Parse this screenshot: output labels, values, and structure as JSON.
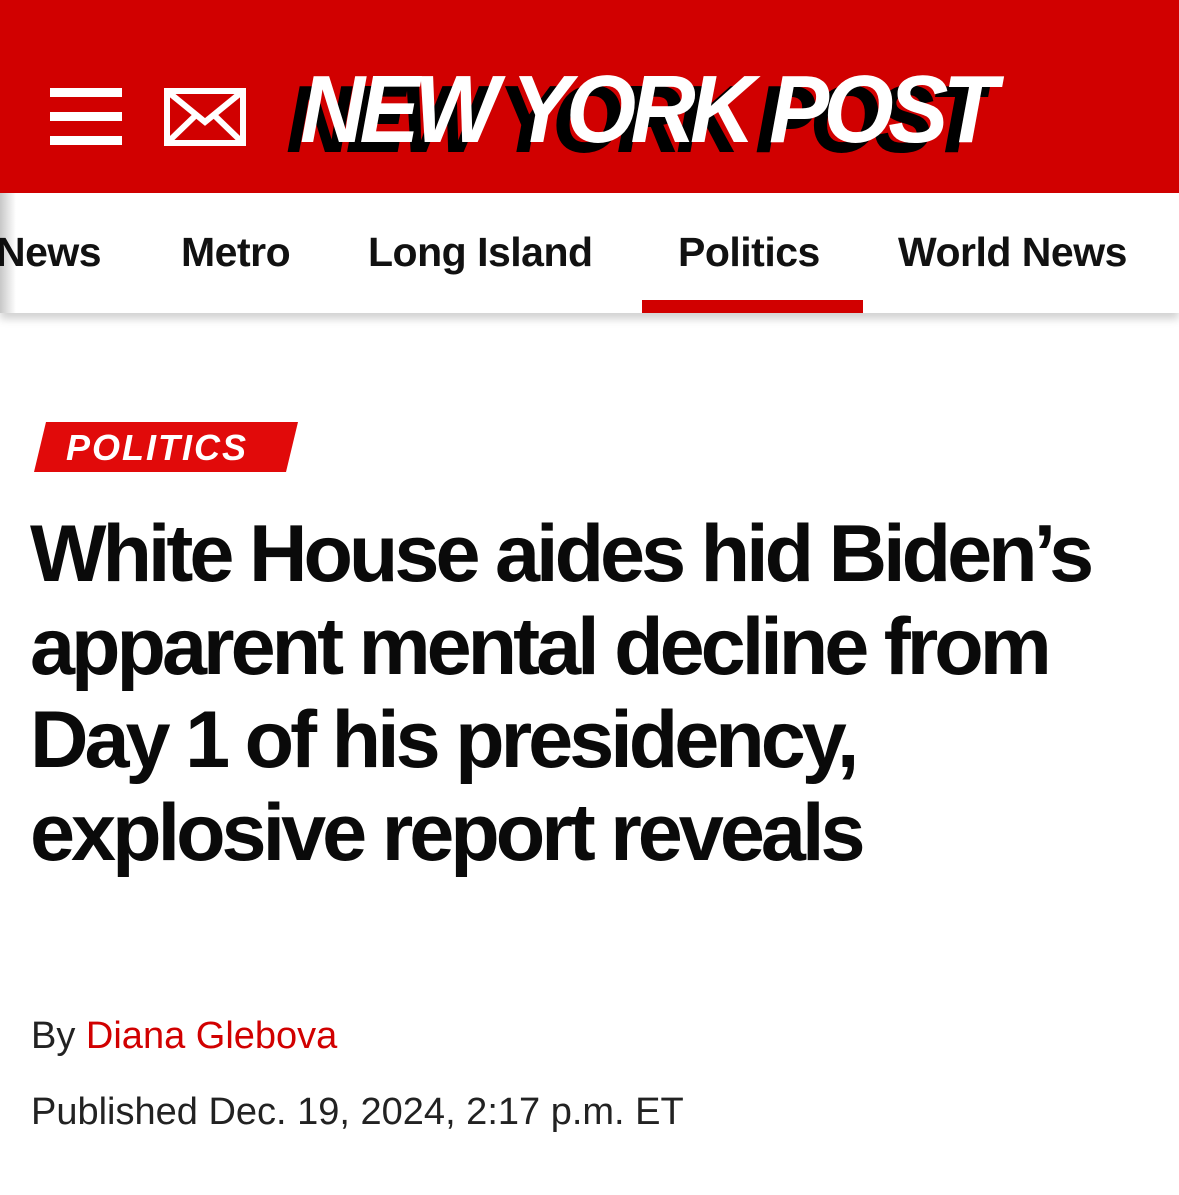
{
  "header": {
    "brand_color": "#d10000",
    "logo_text": "NEW YORK POST",
    "menu_icon": "hamburger-menu-icon",
    "mail_icon": "envelope-icon"
  },
  "nav": {
    "items": [
      {
        "label": "News"
      },
      {
        "label": "Metro"
      },
      {
        "label": "Long Island"
      },
      {
        "label": "Politics",
        "active": true
      },
      {
        "label": "World News"
      }
    ],
    "active_color": "#d10000"
  },
  "article": {
    "category": "POLITICS",
    "headline": "White House aides hid Biden’s apparent mental decline from Day 1 of his presidency, explosive report reveals",
    "byline_prefix": "By",
    "author": "Diana Glebova",
    "published": "Published Dec. 19, 2024, 2:17 p.m. ET",
    "author_color": "#d10000"
  }
}
